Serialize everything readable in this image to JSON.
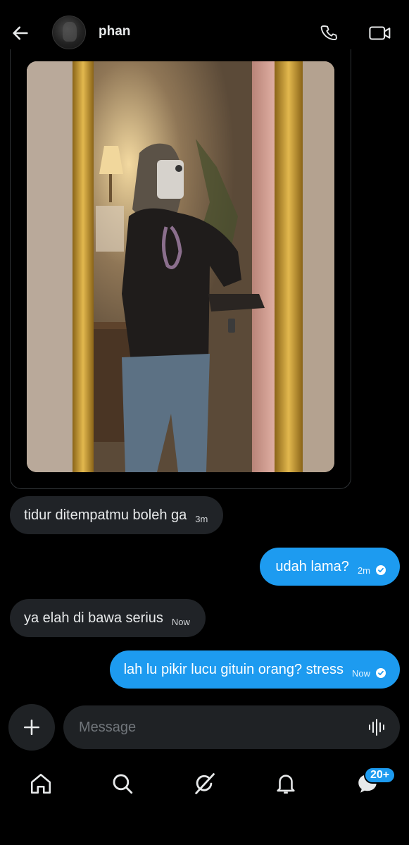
{
  "header": {
    "contact_name": "phan",
    "icons": {
      "back": "arrow-left-icon",
      "call": "phone-icon",
      "video": "video-camera-icon"
    }
  },
  "messages": [
    {
      "direction": "incoming",
      "text": "tidur ditempatmu boleh ga",
      "time": "3m"
    },
    {
      "direction": "outgoing",
      "text": "udah lama?",
      "time": "2m",
      "status": "read"
    },
    {
      "direction": "incoming",
      "text": "ya elah di bawa serius",
      "time": "Now"
    },
    {
      "direction": "outgoing",
      "text": "lah lu pikir lucu gituin orang? stress",
      "time": "Now",
      "status": "read"
    }
  ],
  "composer": {
    "placeholder": "Message",
    "icons": {
      "add": "plus-icon",
      "voice": "voice-wave-icon"
    }
  },
  "nav": {
    "items": [
      "home-icon",
      "search-icon",
      "grok-icon",
      "notifications-icon",
      "messages-icon"
    ],
    "messages_badge": "20+"
  },
  "colors": {
    "background": "#000000",
    "incoming_bubble": "#202327",
    "outgoing_bubble": "#1d9bf0",
    "input_bg": "#1f2225"
  }
}
